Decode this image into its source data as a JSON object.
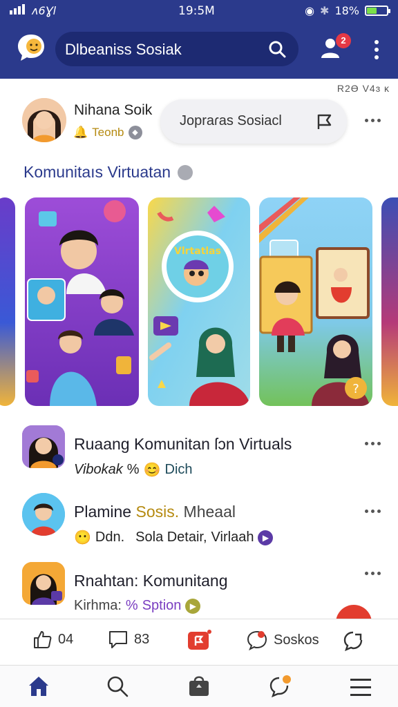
{
  "status_bar": {
    "carrier": "ᴧ6Ɣl",
    "time": "19:5M",
    "battery": "18%",
    "battery_level": 0.18
  },
  "app_bar": {
    "search_label": "Dlbeaniss Sosiak",
    "notification_count": "2"
  },
  "corner_text": "R2Ө V4ɜ ĸ",
  "profile": {
    "name": "Nihana Soik",
    "badge": "Teonb",
    "post_prompt": "Jopraɾas Sosiacl"
  },
  "section": {
    "title": "Komunitaıs Virtuatan"
  },
  "stories": [
    {
      "id": "story-partial-left"
    },
    {
      "id": "story-family"
    },
    {
      "id": "story-virtual",
      "sticker_text": "Vlrtatlas"
    },
    {
      "id": "story-frames"
    },
    {
      "id": "story-partial-right"
    }
  ],
  "feed": [
    {
      "title": "Ruaang Komunitan ſɔn Virtuals",
      "sub_a": "Vibokak",
      "sub_b": "%",
      "sub_c": "Dich"
    },
    {
      "title_a": "Plamine",
      "title_b": "Sosis.",
      "title_c": "Mheaal",
      "sub_a": "Ddn.",
      "sub_b": "Sola Detair,",
      "sub_c": "Virlaah"
    },
    {
      "title": "Rnahtan: Komunitang",
      "sub_a": "Kirhma:",
      "sub_b": "%",
      "sub_c": "Sption"
    }
  ],
  "actions": {
    "like_count": "04",
    "comment_count": "83",
    "share_label": "Soskos"
  },
  "colors": {
    "brand": "#2b3a8c",
    "search_bg": "#1d2a72",
    "badge": "#e53945",
    "accent_purple": "#7a3ec1",
    "accent_gold": "#b58a10"
  }
}
